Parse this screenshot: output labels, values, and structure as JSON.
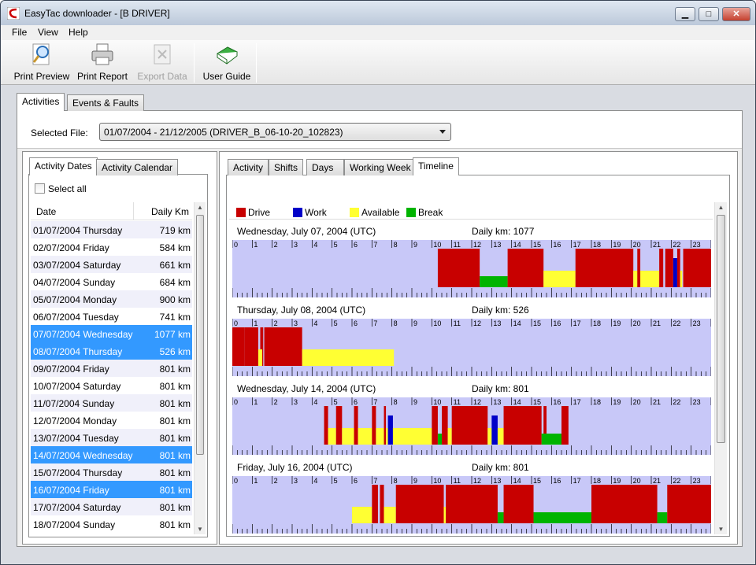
{
  "window": {
    "title": "EasyTac downloader - [B DRIVER]"
  },
  "menu": [
    "File",
    "View",
    "Help"
  ],
  "toolbar": {
    "print_preview": "Print Preview",
    "print_report": "Print Report",
    "export_data": "Export Data",
    "user_guide": "User Guide"
  },
  "main_tabs": [
    "Activities",
    "Events & Faults"
  ],
  "selected_file": {
    "label": "Selected File:",
    "value": "01/07/2004 - 21/12/2005 (DRIVER_B_06-10-20_102823)"
  },
  "left_tabs": [
    "Activity Dates",
    "Activity Calendar"
  ],
  "select_all": "Select all",
  "list": {
    "headers": {
      "date": "Date",
      "km": "Daily Km"
    },
    "rows": [
      {
        "date": "01/07/2004 Thursday",
        "km": "719 km",
        "selected": false
      },
      {
        "date": "02/07/2004 Friday",
        "km": "584 km",
        "selected": false
      },
      {
        "date": "03/07/2004 Saturday",
        "km": "661 km",
        "selected": false
      },
      {
        "date": "04/07/2004 Sunday",
        "km": "684 km",
        "selected": false
      },
      {
        "date": "05/07/2004 Monday",
        "km": "900 km",
        "selected": false
      },
      {
        "date": "06/07/2004 Tuesday",
        "km": "741 km",
        "selected": false
      },
      {
        "date": "07/07/2004 Wednesday",
        "km": "1077 km",
        "selected": true
      },
      {
        "date": "08/07/2004 Thursday",
        "km": "526 km",
        "selected": true
      },
      {
        "date": "09/07/2004 Friday",
        "km": "801 km",
        "selected": false
      },
      {
        "date": "10/07/2004 Saturday",
        "km": "801 km",
        "selected": false
      },
      {
        "date": "11/07/2004 Sunday",
        "km": "801 km",
        "selected": false
      },
      {
        "date": "12/07/2004 Monday",
        "km": "801 km",
        "selected": false
      },
      {
        "date": "13/07/2004 Tuesday",
        "km": "801 km",
        "selected": false
      },
      {
        "date": "14/07/2004 Wednesday",
        "km": "801 km",
        "selected": true
      },
      {
        "date": "15/07/2004 Thursday",
        "km": "801 km",
        "selected": false
      },
      {
        "date": "16/07/2004 Friday",
        "km": "801 km",
        "selected": true
      },
      {
        "date": "17/07/2004 Saturday",
        "km": "801 km",
        "selected": false
      },
      {
        "date": "18/07/2004 Sunday",
        "km": "801 km",
        "selected": false
      }
    ]
  },
  "right_tabs": [
    "Activity",
    "Shifts",
    "Days",
    "Working Week",
    "Timeline"
  ],
  "legend": [
    {
      "label": "Drive",
      "color": "#c80000"
    },
    {
      "label": "Work",
      "color": "#0000c8"
    },
    {
      "label": "Available",
      "color": "#ffff33"
    },
    {
      "label": "Break",
      "color": "#00b400"
    }
  ],
  "hours": [
    "0",
    "1",
    "2",
    "3",
    "4",
    "5",
    "6",
    "7",
    "8",
    "9",
    "10",
    "11",
    "12",
    "13",
    "14",
    "15",
    "16",
    "17",
    "18",
    "19",
    "20",
    "21",
    "22",
    "23"
  ],
  "timeline": [
    {
      "title": "Wednesday, July 07, 2004 (UTC)",
      "km": "Daily km: 1077",
      "segments": [
        [
          "drive",
          10.3,
          12.4
        ],
        [
          "break",
          12.4,
          13.8
        ],
        [
          "drive",
          13.8,
          15.6
        ],
        [
          "available",
          15.6,
          17.2
        ],
        [
          "drive",
          17.2,
          20.1
        ],
        [
          "available",
          20.1,
          21.4
        ],
        [
          "drive",
          20.3,
          20.45
        ],
        [
          "drive",
          21.4,
          21.6
        ],
        [
          "drive",
          21.7,
          22.1
        ],
        [
          "work",
          22.1,
          22.3
        ],
        [
          "drive",
          22.3,
          22.45
        ],
        [
          "available",
          22.45,
          22.55
        ],
        [
          "drive",
          22.6,
          24
        ]
      ]
    },
    {
      "title": "Thursday, July 08, 2004 (UTC)",
      "km": "Daily km: 526",
      "segments": [
        [
          "drive",
          0,
          0.6
        ],
        [
          "drive",
          0.6,
          1.3
        ],
        [
          "drive",
          1.4,
          1.55
        ],
        [
          "available",
          1.3,
          1.5
        ],
        [
          "drive",
          1.6,
          3.5
        ],
        [
          "available",
          3.5,
          8.1
        ]
      ]
    },
    {
      "title": "Wednesday, July 14, 2004 (UTC)",
      "km": "Daily km: 801",
      "segments": [
        [
          "drive",
          4.6,
          4.8
        ],
        [
          "available",
          4.8,
          5.2
        ],
        [
          "drive",
          5.2,
          5.5
        ],
        [
          "available",
          5.5,
          6.1
        ],
        [
          "drive",
          6.1,
          6.3
        ],
        [
          "available",
          6.3,
          7.0
        ],
        [
          "drive",
          7.0,
          7.2
        ],
        [
          "available",
          7.2,
          7.6
        ],
        [
          "drive",
          7.6,
          7.7
        ],
        [
          "available",
          7.7,
          7.8
        ],
        [
          "work",
          7.8,
          8.05
        ],
        [
          "available",
          8.05,
          10.0
        ],
        [
          "drive",
          10.0,
          10.3
        ],
        [
          "break",
          10.3,
          10.5
        ],
        [
          "drive",
          10.5,
          10.8
        ],
        [
          "available",
          10.8,
          11.0
        ],
        [
          "drive",
          11.0,
          12.8
        ],
        [
          "available",
          12.8,
          13.0
        ],
        [
          "work",
          13.0,
          13.3
        ],
        [
          "available",
          13.3,
          13.6
        ],
        [
          "drive",
          13.6,
          15.5
        ],
        [
          "drive",
          15.6,
          15.75
        ],
        [
          "break",
          15.5,
          16.5
        ],
        [
          "drive",
          16.5,
          16.85
        ]
      ]
    },
    {
      "title": "Friday, July 16, 2004 (UTC)",
      "km": "Daily km: 801",
      "segments": [
        [
          "available",
          6.0,
          7.0
        ],
        [
          "drive",
          7.0,
          7.3
        ],
        [
          "drive",
          7.4,
          7.6
        ],
        [
          "available",
          7.6,
          8.2
        ],
        [
          "drive",
          8.2,
          10.6
        ],
        [
          "available",
          10.6,
          10.7
        ],
        [
          "drive",
          10.7,
          13.3
        ],
        [
          "break",
          13.3,
          13.6
        ],
        [
          "drive",
          13.6,
          15.1
        ],
        [
          "break",
          15.1,
          18.0
        ],
        [
          "drive",
          18.0,
          21.3
        ],
        [
          "break",
          21.3,
          21.8
        ],
        [
          "drive",
          21.8,
          24
        ]
      ]
    }
  ]
}
